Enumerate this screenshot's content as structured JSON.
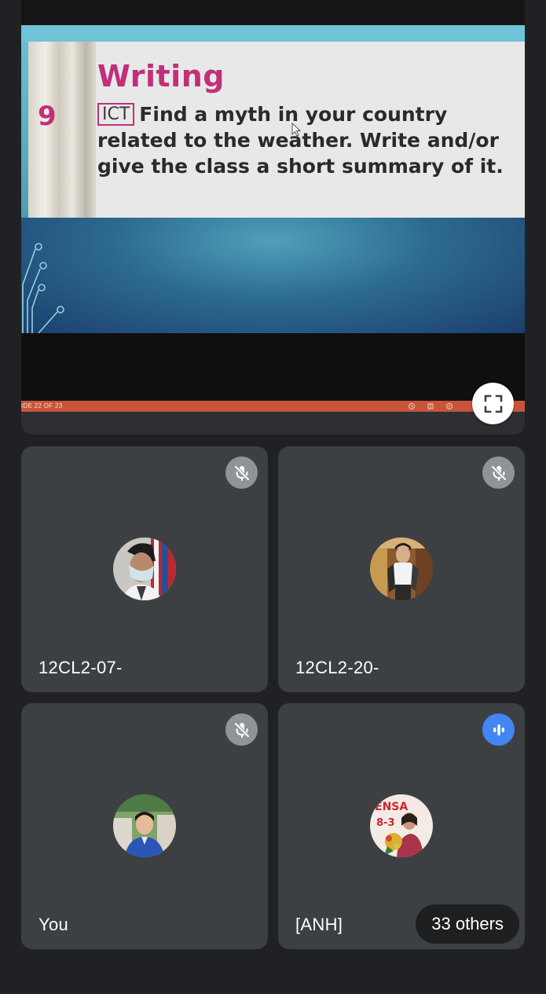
{
  "presentation": {
    "slide": {
      "heading": "Writing",
      "number": "9",
      "badge": "ICT",
      "text": "Find a myth in your country related to the weather. Write and/or give the class a short summary of it."
    },
    "progress_label": "IDE 22 OF 23",
    "fullscreen_icon": "fullscreen-icon"
  },
  "participants": [
    {
      "name": "12CL2-07-",
      "mic": "muted",
      "icon": "mic-off-icon"
    },
    {
      "name": "12CL2-20-",
      "mic": "muted",
      "icon": "mic-off-icon"
    },
    {
      "name": "You",
      "mic": "muted",
      "icon": "mic-off-icon"
    },
    {
      "name": "[ANH]",
      "mic": "speaking",
      "icon": "audio-level-icon"
    }
  ],
  "others_chip": "33 others",
  "colors": {
    "background": "#202124",
    "tile": "#3c4043",
    "speaking": "#4285f4",
    "slide_accent": "#c0307a",
    "slide_bar": "#c8553a"
  }
}
